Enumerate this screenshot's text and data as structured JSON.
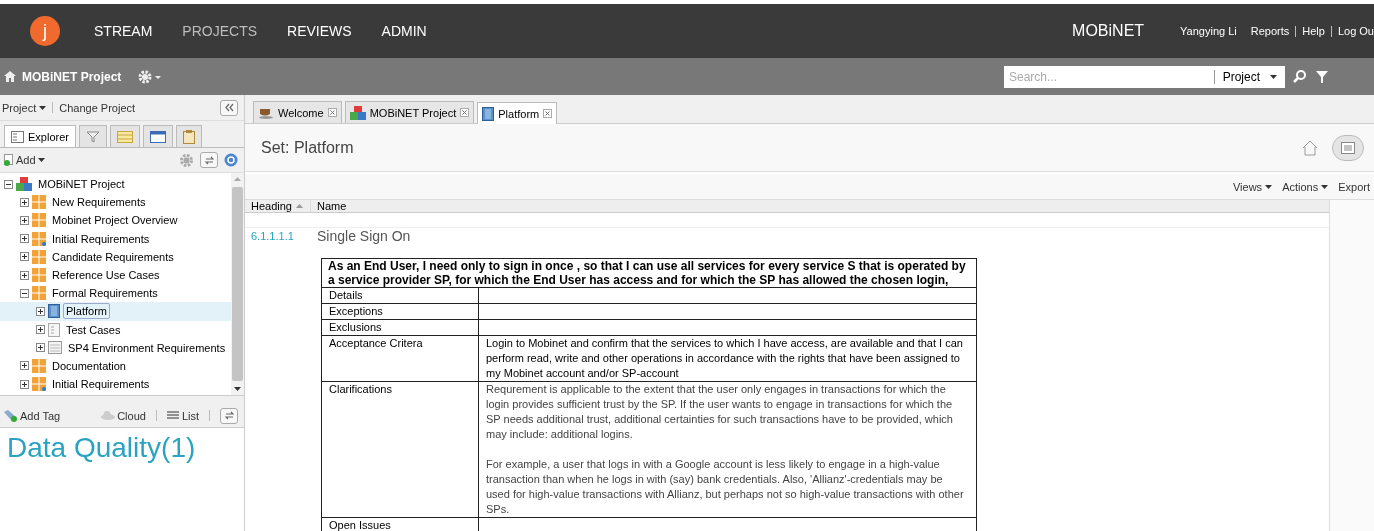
{
  "topbar": {
    "logo": "j",
    "nav": [
      {
        "label": "STREAM",
        "selected": false
      },
      {
        "label": "PROJECTS",
        "selected": true
      },
      {
        "label": "REVIEWS",
        "selected": false
      },
      {
        "label": "ADMIN",
        "selected": false
      }
    ],
    "brand": "MOBiNET",
    "user": "Yangying Li",
    "links": [
      "Reports",
      "Help",
      "Log Ou"
    ]
  },
  "project_bar": {
    "title": "MOBiNET Project",
    "search": {
      "placeholder": "Search...",
      "scope": "Project"
    }
  },
  "sidebar": {
    "project_menu": "Project",
    "change_project": "Change Project",
    "tabs": [
      {
        "kind": "explorer",
        "label": "Explorer",
        "selected": true
      },
      {
        "kind": "filter",
        "selected": false
      },
      {
        "kind": "grid",
        "selected": false
      },
      {
        "kind": "window",
        "selected": false
      },
      {
        "kind": "clipboard",
        "selected": false
      }
    ],
    "add": "Add",
    "tree": [
      {
        "label": "MOBiNET Project",
        "kind": "project",
        "expanded": true,
        "selected": false,
        "children": [
          {
            "label": "New Requirements",
            "kind": "folder",
            "expanded": false,
            "selected": false
          },
          {
            "label": "Mobinet Project Overview",
            "kind": "folder",
            "expanded": false,
            "selected": false
          },
          {
            "label": "Initial Requirements",
            "kind": "folder-linked",
            "expanded": false,
            "selected": false
          },
          {
            "label": "Candidate Requirements",
            "kind": "folder",
            "expanded": false,
            "selected": false
          },
          {
            "label": "Reference Use Cases",
            "kind": "folder",
            "expanded": false,
            "selected": false
          },
          {
            "label": "Formal Requirements",
            "kind": "folder",
            "expanded": true,
            "selected": false,
            "children": [
              {
                "label": "Platform",
                "kind": "set",
                "expanded": false,
                "selected": true
              },
              {
                "label": "Test Cases",
                "kind": "doc",
                "expanded": false,
                "selected": false
              },
              {
                "label": "SP4 Environment Requirements",
                "kind": "list",
                "expanded": false,
                "selected": false
              }
            ]
          },
          {
            "label": "Documentation",
            "kind": "folder",
            "expanded": false,
            "selected": false
          },
          {
            "label": "Initial Requirements",
            "kind": "folder-linked",
            "expanded": false,
            "selected": false
          }
        ]
      }
    ],
    "tag_bar": {
      "add_tag": "Add Tag",
      "cloud": "Cloud",
      "list": "List"
    },
    "tags": [
      "Data Quality(1)"
    ]
  },
  "tabs": [
    {
      "kind": "cup",
      "label": "Welcome",
      "selected": false
    },
    {
      "kind": "project",
      "label": "MOBiNET Project",
      "selected": false
    },
    {
      "kind": "set",
      "label": "Platform",
      "selected": true
    }
  ],
  "page": {
    "title": "Set: Platform",
    "toolbar": [
      "Views",
      "Actions",
      "Export"
    ],
    "columns": [
      "Heading",
      "Name"
    ],
    "item": {
      "number": "6.1.1.1.1",
      "name": "Single Sign On",
      "story": [
        "As an End User, I need only to  sign in once , so that I can use all services for every service S that is operated by",
        "a service provider SP, for which the End User has access and for which the SP has allowed the chosen login,"
      ],
      "rows": [
        {
          "label": "Details",
          "paragraphs": []
        },
        {
          "label": "Exceptions",
          "paragraphs": []
        },
        {
          "label": "Exclusions",
          "paragraphs": []
        },
        {
          "label": "Acceptance Critera",
          "paragraphs": [
            "Login to Mobinet and confirm that the services to which I have access, are available and that I can perform read, write and other operations in accordance with the rights that have been assigned to my Mobinet account and/or SP-account"
          ]
        },
        {
          "label": "Clarifications",
          "paragraphs": [
            "Requrement is applicable to the extent that the user only engages in transactions for which the login provides sufficient trust by the SP. If the user wants to engage in transactions for which the SP needs additional trust, additional certainties for such transactions have to be provided, which may include: additional logins.",
            "For example, a user that logs in with a Google account is less likely to engage in a high-value transaction than when he logs in with (say) bank credentials. Also, 'Allianz'-credentials may be used for high-value transactions with Allianz, but perhaps not so high-value transactions with other SPs."
          ]
        },
        {
          "label": "Open Issues",
          "paragraphs": []
        }
      ]
    }
  }
}
